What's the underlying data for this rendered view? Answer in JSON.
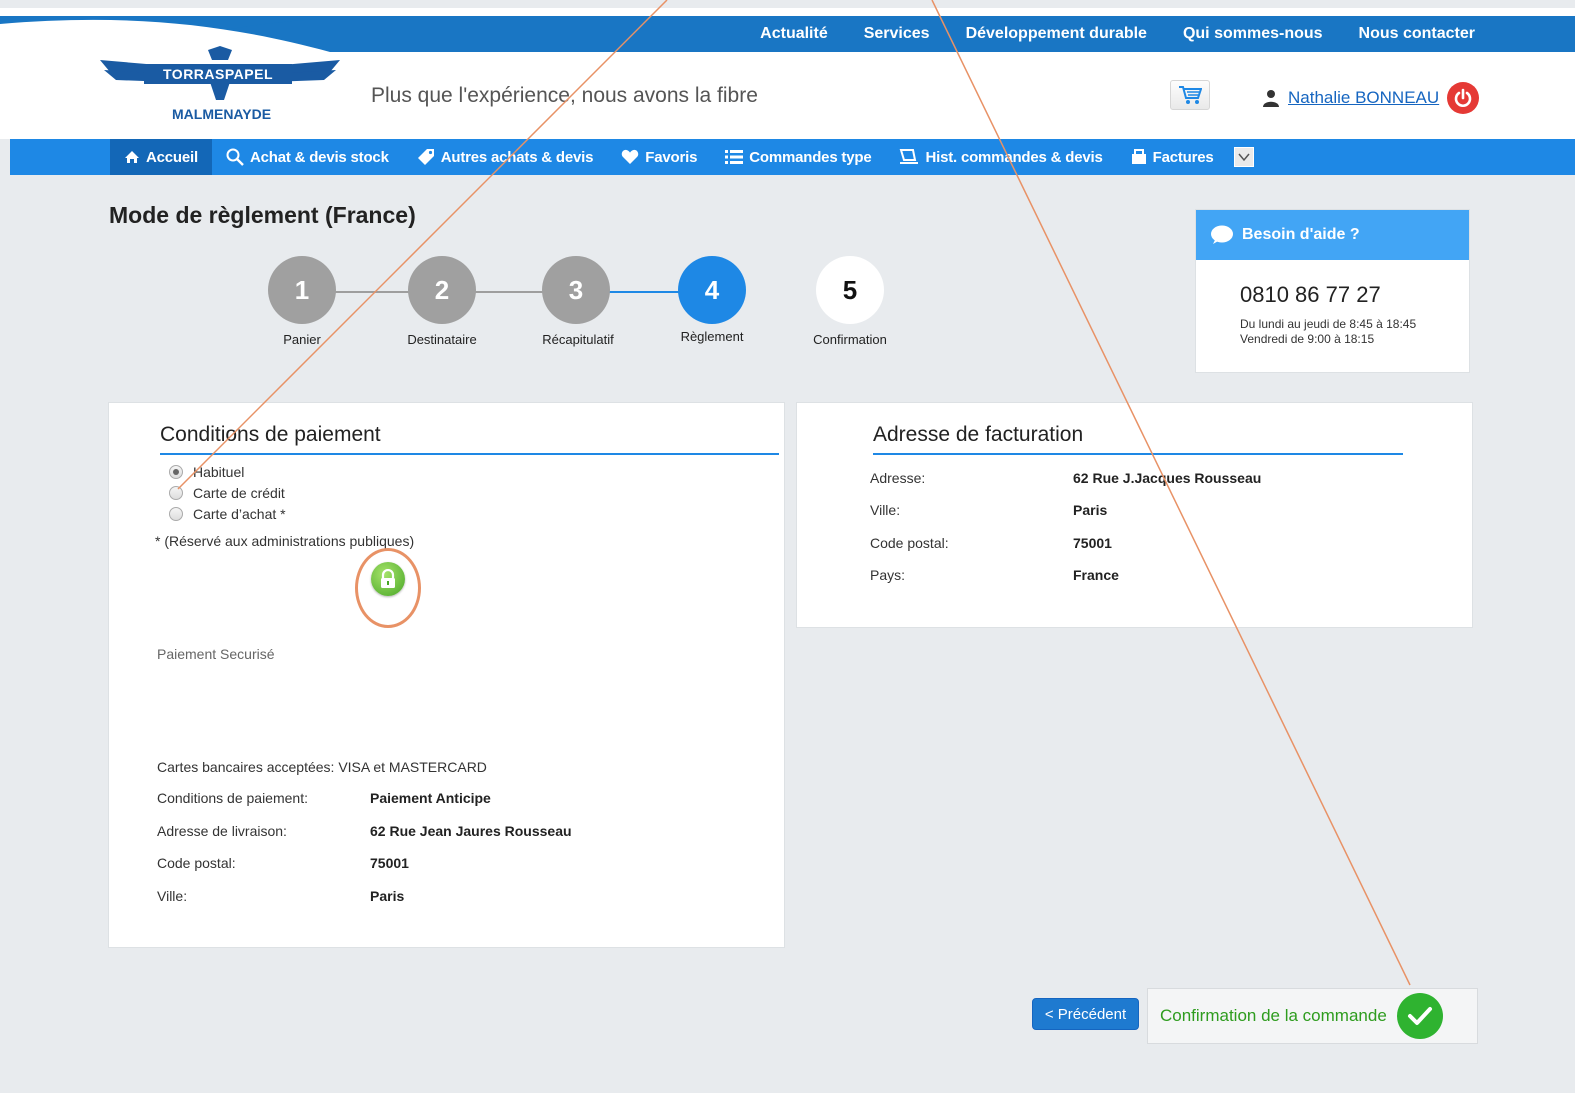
{
  "topnav": {
    "links": [
      "Actualité",
      "Services",
      "Développement durable",
      "Qui sommes-nous",
      "Nous contacter"
    ]
  },
  "logo": {
    "top": "TORRASPAPEL",
    "bottom": "MALMENAYDE"
  },
  "header": {
    "tagline": "Plus que l'expérience, nous avons la fibre",
    "user_name": "Nathalie BONNEAU"
  },
  "mainnav": {
    "items": [
      {
        "label": "Accueil",
        "icon": "home-icon"
      },
      {
        "label": "Achat & devis stock",
        "icon": "search-icon"
      },
      {
        "label": "Autres achats & devis",
        "icon": "tag-icon"
      },
      {
        "label": "Favoris",
        "icon": "heart-icon"
      },
      {
        "label": "Commandes type",
        "icon": "list-icon"
      },
      {
        "label": "Hist. commandes & devis",
        "icon": "cart-outline-icon"
      },
      {
        "label": "Factures",
        "icon": "invoice-icon"
      }
    ]
  },
  "page": {
    "title": "Mode de règlement (France)"
  },
  "stepper": {
    "current": 4,
    "steps": [
      {
        "num": "1",
        "label": "Panier"
      },
      {
        "num": "2",
        "label": "Destinataire"
      },
      {
        "num": "3",
        "label": "Récapitulatif"
      },
      {
        "num": "4",
        "label": "Règlement"
      },
      {
        "num": "5",
        "label": "Confirmation"
      }
    ]
  },
  "help": {
    "title": "Besoin d'aide ?",
    "phone": "0810 86 77 27",
    "hours_1": "Du lundi au jeudi de 8:45 à 18:45",
    "hours_2": "Vendredi de 9:00 à 18:15"
  },
  "payment": {
    "title": "Conditions de paiement",
    "options": [
      {
        "label": "Habituel",
        "checked": true
      },
      {
        "label": "Carte de crédit",
        "checked": false
      },
      {
        "label": "Carte d’achat *",
        "checked": false
      }
    ],
    "note": "* (Réservé aux administrations publiques)",
    "secure": "Paiement Securisé",
    "cards": "Cartes bancaires acceptées: VISA et MASTERCARD",
    "details": [
      {
        "label": "Conditions de paiement:",
        "value": "Paiement Anticipe"
      },
      {
        "label": "Adresse de livraison:",
        "value": "62 Rue Jean Jaures Rousseau"
      },
      {
        "label": "Code postal:",
        "value": "75001"
      },
      {
        "label": "Ville:",
        "value": "Paris"
      }
    ]
  },
  "billing": {
    "title": "Adresse de facturation",
    "rows": [
      {
        "label": "Adresse:",
        "value": "62 Rue J.Jacques Rousseau"
      },
      {
        "label": "Ville:",
        "value": "Paris"
      },
      {
        "label": "Code postal:",
        "value": "75001"
      },
      {
        "label": "Pays:",
        "value": "France"
      }
    ]
  },
  "actions": {
    "prev": "< Précédent",
    "confirm": "Confirmation de la commande"
  },
  "colors": {
    "brand_blue": "#1976c4",
    "nav_blue": "#1e88e5",
    "confirm_green": "#2fb330",
    "annotation": "#e89266"
  }
}
